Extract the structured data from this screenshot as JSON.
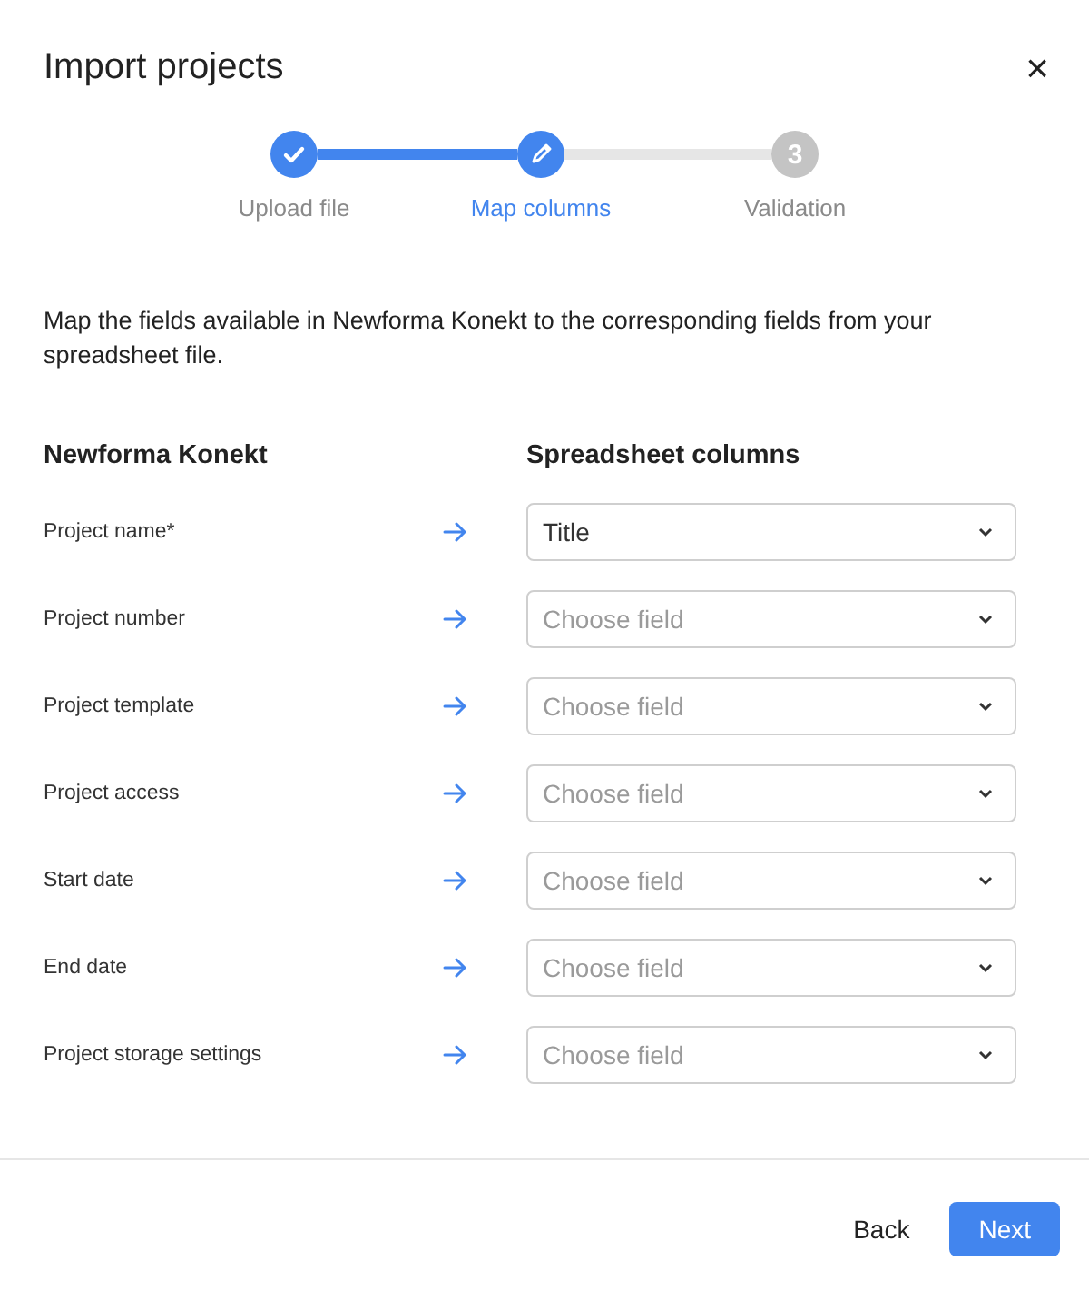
{
  "dialog": {
    "title": "Import projects",
    "close": "×"
  },
  "steps": [
    {
      "label": "Upload file",
      "completed": true,
      "selected": false
    },
    {
      "label": "Map columns",
      "completed": false,
      "selected": true
    },
    {
      "label": "Validation",
      "completed": false,
      "selected": false,
      "number": "3"
    }
  ],
  "description": "Map the fields available in Newforma Konekt to the corresponding fields from your spreadsheet file.",
  "columns": {
    "source": "Newforma Konekt",
    "target": "Spreadsheet columns"
  },
  "mappings": [
    {
      "label": "Project name*",
      "value": "Title"
    },
    {
      "label": "Project number",
      "placeholder": "Choose field"
    },
    {
      "label": "Project template",
      "placeholder": "Choose field"
    },
    {
      "label": "Project access",
      "placeholder": "Choose field"
    },
    {
      "label": "Start date",
      "placeholder": "Choose field"
    },
    {
      "label": "End date",
      "placeholder": "Choose field"
    },
    {
      "label": "Project storage settings",
      "placeholder": "Choose field"
    }
  ],
  "buttons": [
    {
      "label": "Back",
      "kind": "secondary"
    },
    {
      "label": "Next",
      "kind": "primary"
    }
  ]
}
